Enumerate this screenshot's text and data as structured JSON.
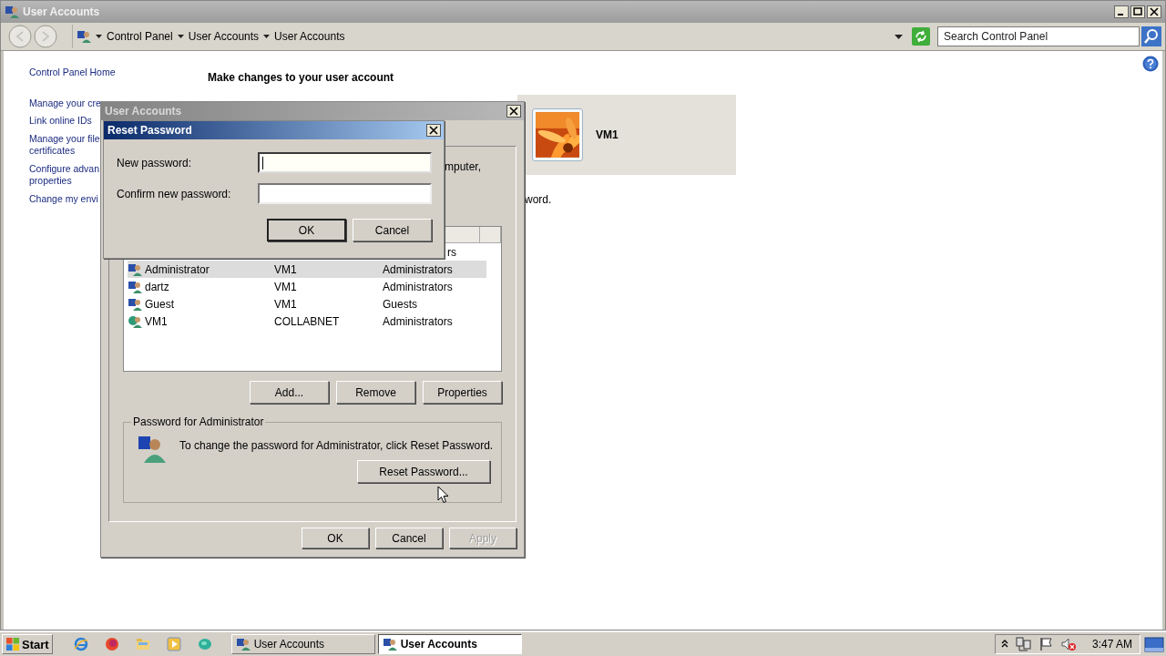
{
  "window": {
    "title": "User Accounts"
  },
  "address_bar": {
    "breadcrumb": [
      "Control Panel",
      "User Accounts",
      "User Accounts"
    ],
    "search": {
      "placeholder": "Search Control Panel"
    }
  },
  "sidebar": {
    "items": [
      {
        "label": "Control Panel Home"
      },
      {
        "label": "Manage your cre"
      },
      {
        "label": "Link online IDs"
      },
      {
        "label": "Manage your file\ncertificates"
      },
      {
        "label": "Configure advan\nproperties"
      },
      {
        "label": "Change my envi"
      }
    ]
  },
  "main": {
    "heading": "Make changes to your user account",
    "account_tile": {
      "name": "VM1"
    },
    "text_fragment": "word."
  },
  "user_accounts_dialog": {
    "title": "User Accounts",
    "active": false,
    "intro_fragment": "mputer,",
    "users": [
      {
        "kind": "partial",
        "group": "rs",
        "selected": false
      },
      {
        "kind": "local",
        "name": "Administrator",
        "domain": "VM1",
        "group": "Administrators",
        "selected": true
      },
      {
        "kind": "local",
        "name": "dartz",
        "domain": "VM1",
        "group": "Administrators",
        "selected": false
      },
      {
        "kind": "local",
        "name": "Guest",
        "domain": "VM1",
        "group": "Guests",
        "selected": false
      },
      {
        "kind": "domain",
        "name": "VM1",
        "domain": "COLLABNET",
        "group": "Administrators",
        "selected": false
      }
    ],
    "buttons": [
      "Add...",
      "Remove",
      "Properties"
    ],
    "password_group": {
      "title": "Password for Administrator",
      "text": "To change the password for Administrator, click Reset Password.",
      "button": "Reset Password..."
    },
    "footer_buttons": [
      {
        "label": "OK",
        "disabled": false
      },
      {
        "label": "Cancel",
        "disabled": false
      },
      {
        "label": "Apply",
        "disabled": true
      }
    ]
  },
  "reset_password_dialog": {
    "title": "Reset Password",
    "active": true,
    "fields": [
      {
        "label": "New password:",
        "focused": true
      },
      {
        "label": "Confirm new password:",
        "focused": false
      }
    ],
    "buttons": [
      {
        "label": "OK",
        "default": true
      },
      {
        "label": "Cancel",
        "default": false
      }
    ]
  },
  "taskbar": {
    "start": "Start",
    "tasks": [
      {
        "label": "User Accounts",
        "selected": false
      },
      {
        "label": "User Accounts",
        "selected": true
      }
    ],
    "clock": "3:47 AM"
  }
}
